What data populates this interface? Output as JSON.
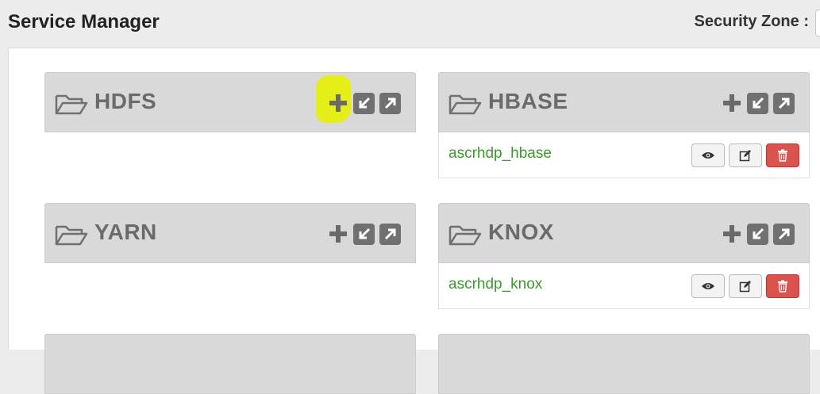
{
  "header": {
    "title": "Service Manager",
    "zone_label": "Security Zone :"
  },
  "services": [
    {
      "name": "HDFS",
      "repos": []
    },
    {
      "name": "HBASE",
      "repos": [
        "ascrhdp_hbase"
      ]
    },
    {
      "name": "YARN",
      "repos": []
    },
    {
      "name": "KNOX",
      "repos": [
        "ascrhdp_knox"
      ]
    }
  ],
  "icons": {
    "folder": "folder-open-icon",
    "add": "plus-icon",
    "import": "import-icon",
    "export": "export-icon",
    "view": "eye-icon",
    "edit": "edit-icon",
    "delete": "trash-icon"
  },
  "colors": {
    "repo_link": "#3a9a2a",
    "highlight": "#e6f000",
    "delete_button": "#d9534f"
  }
}
